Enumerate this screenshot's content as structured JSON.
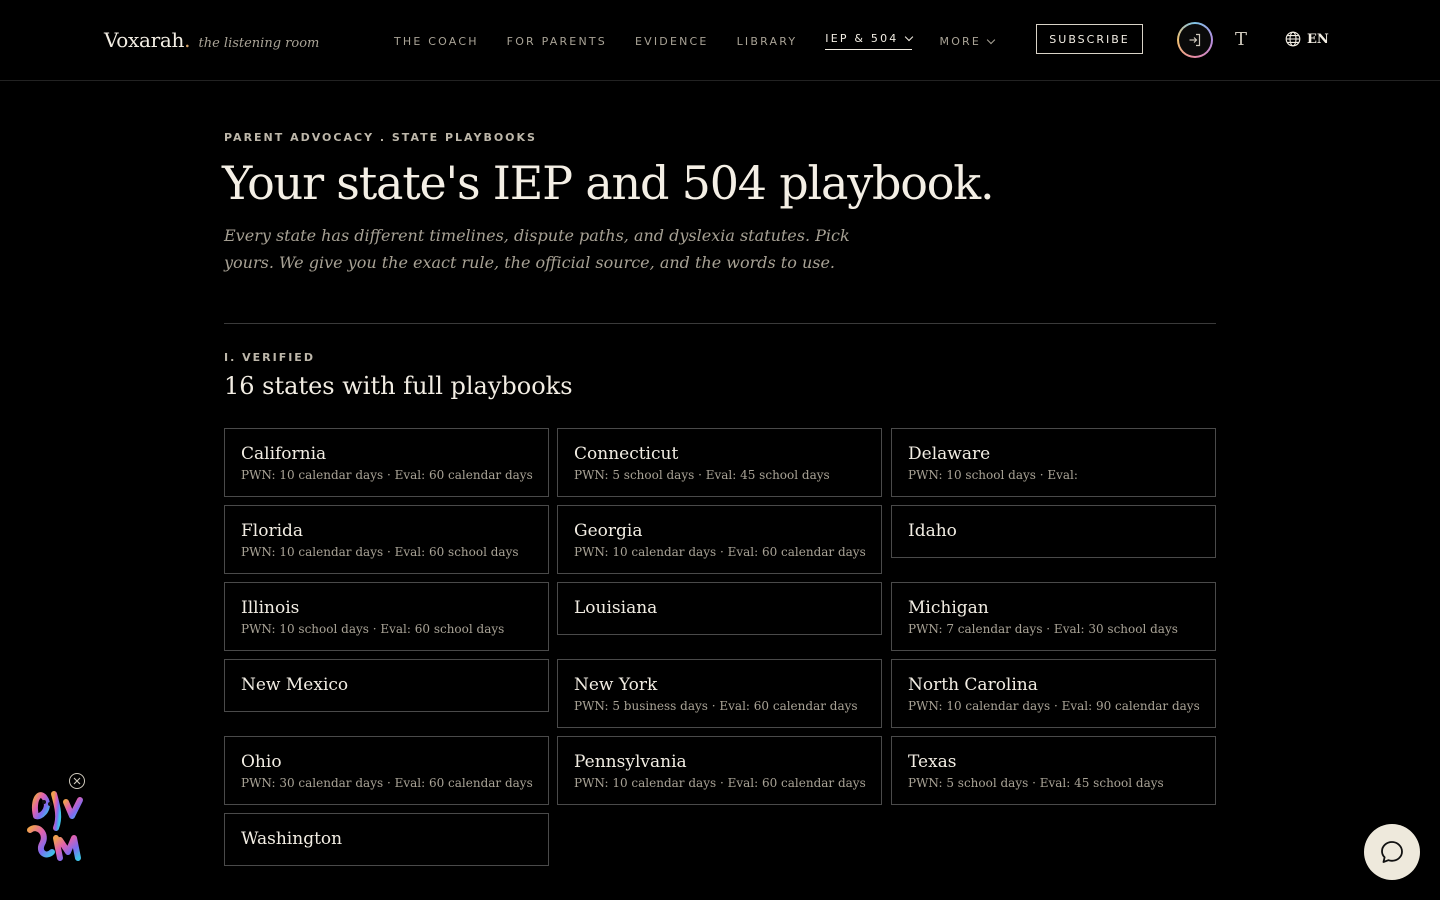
{
  "brand": {
    "name": "Voxarah",
    "dot": ".",
    "tagline": "the listening room"
  },
  "nav": {
    "items": [
      {
        "label": "THE COACH",
        "active": false,
        "dropdown": false
      },
      {
        "label": "FOR PARENTS",
        "active": false,
        "dropdown": false
      },
      {
        "label": "EVIDENCE",
        "active": false,
        "dropdown": false
      },
      {
        "label": "LIBRARY",
        "active": false,
        "dropdown": false
      },
      {
        "label": "IEP & 504",
        "active": true,
        "dropdown": true
      },
      {
        "label": "MORE",
        "active": false,
        "dropdown": true
      }
    ],
    "subscribe_label": "SUBSCRIBE",
    "login_icon": "login-icon",
    "text_size_label": "T",
    "language_label": "EN",
    "language_icon": "globe-icon"
  },
  "hero": {
    "eyebrow": "PARENT ADVOCACY . STATE PLAYBOOKS",
    "title": "Your state's IEP and 504 playbook.",
    "intro": "Every state has different timelines, dispute paths, and dyslexia statutes. Pick yours. We give you the exact rule, the official source, and the words to use."
  },
  "verified": {
    "eyebrow": "I. VERIFIED",
    "title": "16 states with full playbooks",
    "states": [
      {
        "name": "California",
        "meta": "PWN: 10 calendar days · Eval: 60 calendar days"
      },
      {
        "name": "Connecticut",
        "meta": "PWN: 5 school days · Eval: 45 school days"
      },
      {
        "name": "Delaware",
        "meta": "PWN: 10 school days · Eval:"
      },
      {
        "name": "Florida",
        "meta": "PWN: 10 calendar days · Eval: 60 school days"
      },
      {
        "name": "Georgia",
        "meta": "PWN: 10 calendar days · Eval: 60 calendar days"
      },
      {
        "name": "Idaho",
        "meta": ""
      },
      {
        "name": "Illinois",
        "meta": "PWN: 10 school days · Eval: 60 school days"
      },
      {
        "name": "Louisiana",
        "meta": ""
      },
      {
        "name": "Michigan",
        "meta": "PWN: 7 calendar days · Eval: 30 school days"
      },
      {
        "name": "New Mexico",
        "meta": ""
      },
      {
        "name": "New York",
        "meta": "PWN: 5 business days · Eval: 60 calendar days"
      },
      {
        "name": "North Carolina",
        "meta": "PWN: 10 calendar days · Eval: 90 calendar days"
      },
      {
        "name": "Ohio",
        "meta": "PWN: 30 calendar days · Eval: 60 calendar days"
      },
      {
        "name": "Pennsylvania",
        "meta": "PWN: 10 calendar days · Eval: 60 calendar days"
      },
      {
        "name": "Texas",
        "meta": "PWN: 5 school days · Eval: 45 school days"
      },
      {
        "name": "Washington",
        "meta": ""
      }
    ]
  },
  "widgets": {
    "mascot_icon": "mascot-icon",
    "close_icon": "close-icon",
    "chat_icon": "chat-bubble-icon"
  },
  "colors": {
    "background": "#000000",
    "text": "#f2ede3",
    "muted": "#a9a396",
    "border": "#4a4a4a",
    "chat_button": "#eee9dc"
  }
}
